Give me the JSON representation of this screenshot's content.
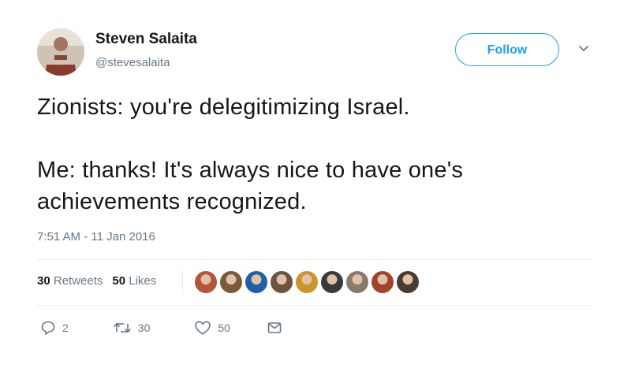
{
  "author": {
    "name": "Steven Salaita",
    "handle": "@stevesalaita",
    "avatar_icon": "user-avatar-photo"
  },
  "follow_label": "Follow",
  "tweet": {
    "line1": "Zionists:  you're delegitimizing Israel.",
    "line2": "Me:  thanks!  It's always nice to have one's achievements recognized."
  },
  "timestamp": "7:51 AM - 11 Jan 2016",
  "stats": {
    "retweets_count": "30",
    "retweets_label": "Retweets",
    "likes_count": "50",
    "likes_label": "Likes"
  },
  "liker_avatars": [
    "#b5553a",
    "#7a5a3a",
    "#1f5fa8",
    "#6b5442",
    "#c9962a",
    "#3a3a3a",
    "#8a7a6a",
    "#a0452a",
    "#4a3a30"
  ],
  "actions": {
    "reply_count": "2",
    "retweet_count": "30",
    "like_count": "50"
  },
  "colors": {
    "accent": "#1da1f2",
    "muted": "#657786",
    "text": "#14171a"
  }
}
